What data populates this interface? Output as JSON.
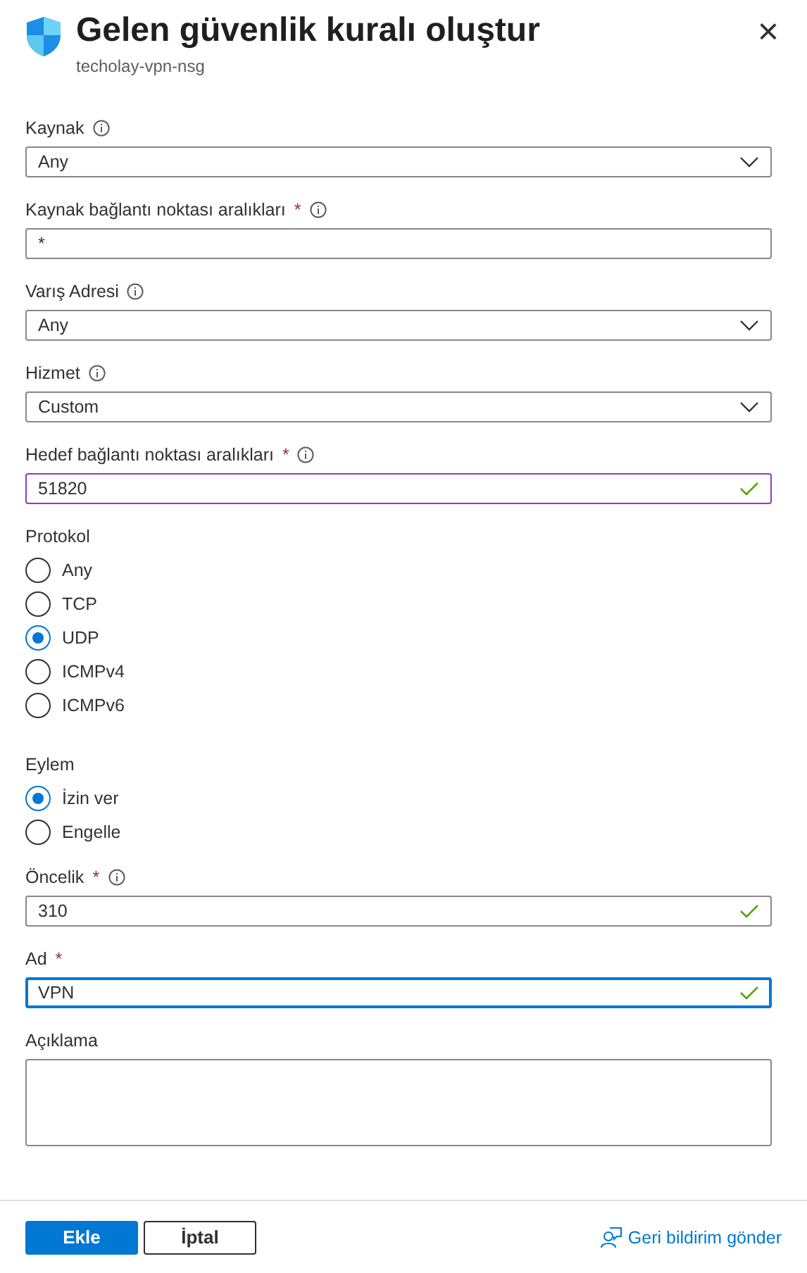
{
  "header": {
    "title": "Gelen güvenlik kuralı oluştur",
    "subtitle": "techolay-vpn-nsg",
    "close": "×"
  },
  "fields": [
    {
      "kind": "dropdown",
      "label": "Kaynak",
      "required": false,
      "info": true,
      "value": "Any"
    },
    {
      "kind": "text",
      "label": "Kaynak bağlantı noktası aralıkları",
      "required": true,
      "info": true,
      "value": "*",
      "valid": false
    },
    {
      "kind": "dropdown",
      "label": "Varış Adresi",
      "required": false,
      "info": true,
      "value": "Any"
    },
    {
      "kind": "dropdown",
      "label": "Hizmet",
      "required": false,
      "info": true,
      "value": "Custom"
    },
    {
      "kind": "text",
      "label": "Hedef bağlantı noktası aralıkları",
      "required": true,
      "info": true,
      "value": "51820",
      "valid": true,
      "hovered": true
    },
    {
      "kind": "radio",
      "label": "Protokol",
      "required": false,
      "info": false,
      "options": [
        {
          "label": "Any",
          "selected": false
        },
        {
          "label": "TCP",
          "selected": false
        },
        {
          "label": "UDP",
          "selected": true
        },
        {
          "label": "ICMPv4",
          "selected": false
        },
        {
          "label": "ICMPv6",
          "selected": false
        }
      ]
    },
    {
      "kind": "radio",
      "label": "Eylem",
      "required": false,
      "info": false,
      "options": [
        {
          "label": "İzin ver",
          "selected": true
        },
        {
          "label": "Engelle",
          "selected": false
        }
      ]
    },
    {
      "kind": "text",
      "label": "Öncelik",
      "required": true,
      "info": true,
      "value": "310",
      "valid": true
    },
    {
      "kind": "text",
      "label": "Ad",
      "required": true,
      "info": false,
      "value": "VPN",
      "valid": true,
      "focused": true
    },
    {
      "kind": "textarea",
      "label": "Açıklama",
      "required": false,
      "info": false
    }
  ],
  "footer": {
    "primary": "Ekle",
    "secondary": "İptal",
    "feedback": "Geri bildirim gönder"
  }
}
